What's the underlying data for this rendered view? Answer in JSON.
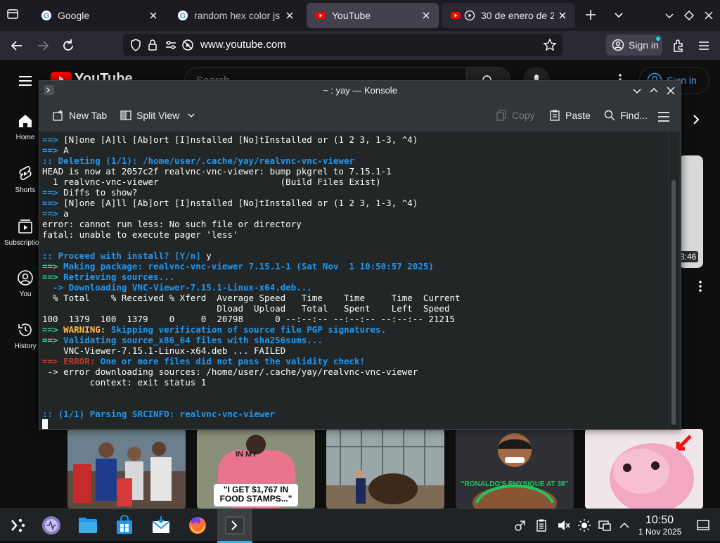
{
  "firefox": {
    "tabs": [
      {
        "title": "Google"
      },
      {
        "title": "random hex color js -"
      },
      {
        "title": "YouTube"
      },
      {
        "title": "30 de enero de 2"
      }
    ],
    "url": "www.youtube.com",
    "sign_in": "Sign in"
  },
  "youtube": {
    "logo_text": "YouTube",
    "search_placeholder": "Search",
    "sign_in": "Sign in",
    "guide": [
      {
        "label": "Home"
      },
      {
        "label": "Shorts"
      },
      {
        "label": "Subscriptions"
      },
      {
        "label": "You"
      },
      {
        "label": "History"
      }
    ],
    "duration": "3:46",
    "thumb_captions": [
      "\"I GET $1,767 IN FOOD STAMPS...\"",
      "\"RONALDO'S PHYSIQUE AT 38\""
    ],
    "thumb_banner": "IN MY"
  },
  "konsole": {
    "title": "~ : yay — Konsole",
    "toolbar": {
      "new_tab": "New Tab",
      "split_view": "Split View",
      "copy": "Copy",
      "paste": "Paste",
      "find": "Find..."
    },
    "lines": [
      [
        {
          "c": "b",
          "t": "==>"
        },
        {
          "t": " [N]one [A]ll [Ab]ort [I]nstalled [No]tInstalled or (1 2 3, 1-3, ^4)"
        }
      ],
      [
        {
          "c": "b",
          "t": "==>"
        },
        {
          "t": " A"
        }
      ],
      [
        {
          "c": "b",
          "t": ":: Deleting (1/1): /home/user/.cache/yay/realvnc-vnc-viewer"
        }
      ],
      [
        {
          "t": "HEAD is now at 2057c2f realvnc-vnc-viewer: bump pkgrel to 7.15.1-1"
        }
      ],
      [
        {
          "t": "  1 realvnc-vnc-viewer                       (Build Files Exist)"
        }
      ],
      [
        {
          "c": "b",
          "t": "==>"
        },
        {
          "t": " Diffs to show?"
        }
      ],
      [
        {
          "c": "b",
          "t": "==>"
        },
        {
          "t": " [N]one [A]ll [Ab]ort [I]nstalled [No]tInstalled or (1 2 3, 1-3, ^4)"
        }
      ],
      [
        {
          "c": "b",
          "t": "==>"
        },
        {
          "t": " a"
        }
      ],
      [
        {
          "t": "error: cannot run less: No such file or directory"
        }
      ],
      [
        {
          "t": "fatal: unable to execute pager 'less'"
        }
      ],
      [
        {
          "t": ""
        }
      ],
      [
        {
          "c": "b",
          "t": ":: Proceed with install? [Y/n]"
        },
        {
          "t": " y"
        }
      ],
      [
        {
          "c": "g",
          "t": "==>"
        },
        {
          "c": "b",
          "t": " Making package: realvnc-vnc-viewer 7.15.1-1 (Sat Nov  1 10:50:57 2025)"
        }
      ],
      [
        {
          "c": "g",
          "t": "==>"
        },
        {
          "c": "b",
          "t": " Retrieving sources..."
        }
      ],
      [
        {
          "c": "b",
          "t": "  -> Downloading VNC-Viewer-7.15.1-Linux-x64.deb..."
        }
      ],
      [
        {
          "t": "  % Total    % Received % Xferd  Average Speed   Time    Time     Time  Current"
        }
      ],
      [
        {
          "t": "                                 Dload  Upload   Total   Spent    Left  Speed"
        }
      ],
      [
        {
          "t": "100  1379  100  1379    0     0  20798      0 --:--:-- --:--:-- --:--:-- 21215"
        }
      ],
      [
        {
          "c": "g",
          "t": "==>"
        },
        {
          "c": "y",
          "t": " WARNING:"
        },
        {
          "c": "b",
          "t": " Skipping verification of source file PGP signatures."
        }
      ],
      [
        {
          "c": "g",
          "t": "==>"
        },
        {
          "c": "b",
          "t": " Validating source_x86_64 files with sha256sums..."
        }
      ],
      [
        {
          "t": "    VNC-Viewer-7.15.1-Linux-x64.deb ... FAILED"
        }
      ],
      [
        {
          "c": "r",
          "t": "==> ERROR:"
        },
        {
          "c": "b",
          "t": " One or more files did not pass the validity check!"
        }
      ],
      [
        {
          "t": " -> error downloading sources: /home/user/.cache/yay/realvnc-vnc-viewer"
        }
      ],
      [
        {
          "t": "         context: exit status 1"
        }
      ],
      [
        {
          "t": ""
        }
      ],
      [
        {
          "t": ""
        }
      ],
      [
        {
          "c": "b",
          "t": ":: (1/1) Parsing SRCINFO: realvnc-vnc-viewer"
        }
      ]
    ]
  },
  "taskbar": {
    "time": "10:50",
    "date": "1 Nov 2025"
  },
  "colors": {
    "accent_blue": "#1d99f3",
    "term_green": "#1cdc9a",
    "term_yellow": "#fdbc4b",
    "term_red": "#c0392b",
    "youtube_red": "#ff0000",
    "link_blue": "#3ea6ff"
  }
}
